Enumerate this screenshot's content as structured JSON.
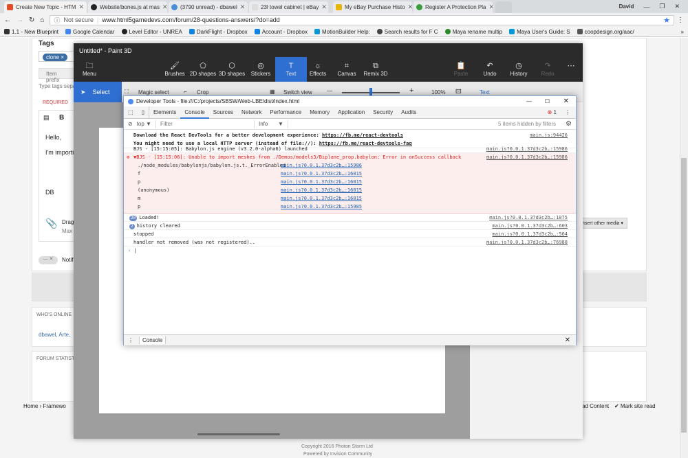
{
  "browser": {
    "tabs": [
      {
        "title": "Create New Topic - HTM"
      },
      {
        "title": "Website/bones.js at mas"
      },
      {
        "title": "(3790 unread) - dbawel"
      },
      {
        "title": "23l towel cabinet | eBay"
      },
      {
        "title": "My eBay Purchase Histo"
      },
      {
        "title": "Register A Protection Pla"
      }
    ],
    "profile": "David",
    "secure_label": "Not secure",
    "url": "www.html5gamedevs.com/forum/28-questions-answers/?do=add",
    "bookmarks": [
      "1.1 - New Blueprint",
      "Google Calendar",
      "Level Editor - UNREA",
      "DarkFlight - Dropbox",
      "Account - Dropbox",
      "MotionBuilder Help:",
      "Search results for F C",
      "Maya rename multip",
      "Maya User's Guide: S",
      "coopdesign.org/aac/"
    ]
  },
  "site": {
    "tags_label": "Tags",
    "tag": "clone ×",
    "item_prefix": "Item prefix",
    "type_tags": "Type tags separ",
    "required": "REQUIRED",
    "bold": "B",
    "body_lines": [
      "Hello,",
      "I'm importi",
      "DB"
    ],
    "drag_label": "Drag",
    "max_label": "Max",
    "insert_media": "Insert other media ▾",
    "notify_label": "Notif",
    "whos_online": "WHO'S ONLINE",
    "online_users": "dbawel, Arte,",
    "forum_stats": "FORUM STATIST",
    "breadcrumb": "Home › Framewo",
    "read_content": "ad Content",
    "mark_read": "✔ Mark site read",
    "copyright": "Copyright 2016 Photon Storm Ltd",
    "powered": "Powered by Invision Community"
  },
  "paint": {
    "title": "Untitled* - Paint 3D",
    "menu": "Menu",
    "tools": [
      "Brushes",
      "2D shapes",
      "3D shapes",
      "Stickers",
      "Text",
      "Effects",
      "Canvas",
      "Remix 3D"
    ],
    "right_tools": [
      "Paste",
      "Undo",
      "History",
      "Redo"
    ],
    "select": "Select",
    "magic_select": "Magic select",
    "crop": "Crop",
    "switch_view": "Switch view",
    "zoom": "100%",
    "text_tag": "Text"
  },
  "devtools": {
    "title": "Developer Tools - file:///C:/projects/SBSW/Web-LBE/dist/index.html",
    "tabs": [
      "Elements",
      "Console",
      "Sources",
      "Network",
      "Performance",
      "Memory",
      "Application",
      "Security",
      "Audits"
    ],
    "error_count": "1",
    "context": "top",
    "filter_placeholder": "Filter",
    "level": "Info",
    "hidden": "5 items hidden by filters",
    "devtools_msg1": "Download the React DevTools for a better development experience: ",
    "devtools_link1": "https://fb.me/react-devtools",
    "devtools_msg2": "You might need to use a local HTTP server (instead of file://): ",
    "devtools_link2": "https://fb.me/react-devtools-faq",
    "src_main": "main.js:94426",
    "engine_msg": "BJS - [15:15:05]: Babylon.js engine (v3.2.0-alpha6) launched",
    "src_engine": "main.js?0.0.1.37d3c2b…:15986",
    "error_msg": "▼BJS - [15:15:06]: Unable to import meshes from ./Demos/models3/Biplane_prop.babylon: Error in onSuccess callback",
    "src_error": "main.js?0.0.1.37d3c2b…:15986",
    "stack": [
      {
        "fn": "./node_modules/babylonjs/babylon.js.t._ErrorEnabled",
        "src": "main.js?0.0.1.37d3c2b…:15986"
      },
      {
        "fn": "f",
        "src": "main.js?0.0.1.37d3c2b…:16015"
      },
      {
        "fn": "p",
        "src": "main.js?0.0.1.37d3c2b…:16015"
      },
      {
        "fn": "(anonymous)",
        "src": "main.js?0.0.1.37d3c2b…:16015"
      },
      {
        "fn": "m",
        "src": "main.js?0.0.1.37d3c2b…:16015"
      },
      {
        "fn": "p",
        "src": "main.js?0.0.1.37d3c2b…:15985"
      }
    ],
    "logs": [
      {
        "badge": "20",
        "msg": "Loaded!",
        "src": "main.js?0.0.1.37d3c2b…:1075"
      },
      {
        "badge": "2",
        "msg": "history cleared",
        "src": "main.js?0.0.1.37d3c2b…:603"
      },
      {
        "badge": "",
        "msg": "stopped",
        "src": "main.js?0.0.1.37d3c2b…:564"
      },
      {
        "badge": "",
        "msg": "handler not removed (was not registered)..",
        "src": "main.js?0.0.1.37d3c2b…:76988"
      }
    ],
    "prompt": "›",
    "drawer_tab": "Console"
  }
}
